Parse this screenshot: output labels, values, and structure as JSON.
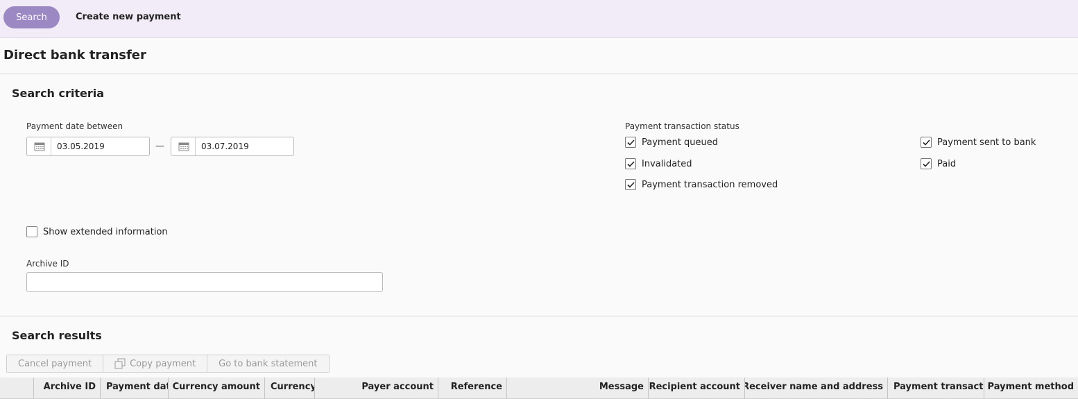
{
  "topbar": {
    "search_label": "Search",
    "create_label": "Create new payment"
  },
  "page": {
    "title": "Direct bank transfer"
  },
  "criteria": {
    "title": "Search criteria",
    "date_label": "Payment date between",
    "date_from": "03.05.2019",
    "date_separator": "—",
    "date_to": "03.07.2019",
    "calendar_icon": "calendar-icon",
    "status_label": "Payment transaction status",
    "statuses": [
      {
        "label": "Payment queued",
        "checked": true
      },
      {
        "label": "Invalidated",
        "checked": true
      },
      {
        "label": "Payment transaction removed",
        "checked": true
      },
      {
        "label": "Payment sent to bank",
        "checked": true
      },
      {
        "label": "Paid",
        "checked": true
      }
    ],
    "extended_label": "Show extended information",
    "extended_checked": false,
    "archive_label": "Archive ID",
    "archive_value": ""
  },
  "results": {
    "title": "Search results",
    "toolbar": {
      "cancel": "Cancel payment",
      "copy": "Copy payment",
      "goto": "Go to bank statement"
    },
    "columns": [
      "Archive ID",
      "Payment dat",
      "Currency amount",
      "Currency",
      "Payer account",
      "Reference",
      "Message",
      "Recipient account",
      "Receiver name and address",
      "Payment transacti",
      "Payment method"
    ]
  },
  "colors": {
    "accent": "#9c89c4",
    "topbar_bg": "#f1ecf7"
  }
}
